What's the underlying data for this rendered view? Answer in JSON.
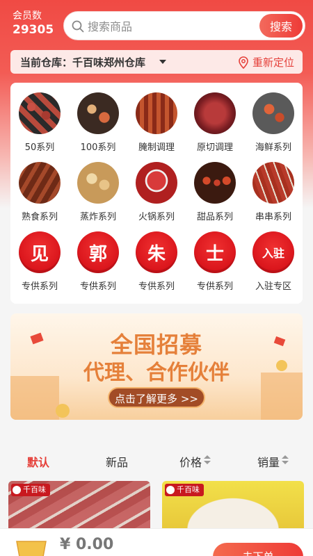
{
  "header": {
    "member_label": "会员数",
    "member_count": "29305",
    "search_placeholder": "搜索商品",
    "search_button": "搜索"
  },
  "warehouse": {
    "label": "当前仓库：千百味郑州仓库",
    "relocate": "重新定位"
  },
  "categories": [
    {
      "label": "50系列",
      "icon": "food-photo-trays"
    },
    {
      "label": "100系列",
      "icon": "food-photo-dishes"
    },
    {
      "label": "腌制调理",
      "icon": "food-photo-marinated"
    },
    {
      "label": "原切调理",
      "icon": "food-photo-steak"
    },
    {
      "label": "海鲜系列",
      "icon": "food-photo-seafood"
    },
    {
      "label": "熟食系列",
      "icon": "food-photo-cooked"
    },
    {
      "label": "蒸炸系列",
      "icon": "food-photo-fried"
    },
    {
      "label": "火锅系列",
      "icon": "food-photo-hotpot"
    },
    {
      "label": "甜品系列",
      "icon": "food-photo-dessert"
    },
    {
      "label": "串串系列",
      "icon": "food-photo-skewers"
    },
    {
      "label": "专供系列",
      "badge": "见"
    },
    {
      "label": "专供系列",
      "badge": "郭"
    },
    {
      "label": "专供系列",
      "badge": "朱"
    },
    {
      "label": "专供系列",
      "badge": "士"
    },
    {
      "label": "入驻专区",
      "badge": "入驻"
    }
  ],
  "banner": {
    "title": "全国招募",
    "subtitle": "代理、合作伙伴",
    "button": "点击了解更多 >>"
  },
  "sort": {
    "default": "默认",
    "new": "新品",
    "price": "价格",
    "sales": "销量"
  },
  "products": [
    {
      "tag": "千百味"
    },
    {
      "tag": "千百味"
    }
  ],
  "bottom": {
    "price": "¥ 0.00",
    "checkout": "去下单"
  },
  "colors": {
    "accent": "#e5403a",
    "header_red": "#f04a44",
    "badge_red": "#d9141b",
    "banner_orange": "#e5803a"
  }
}
